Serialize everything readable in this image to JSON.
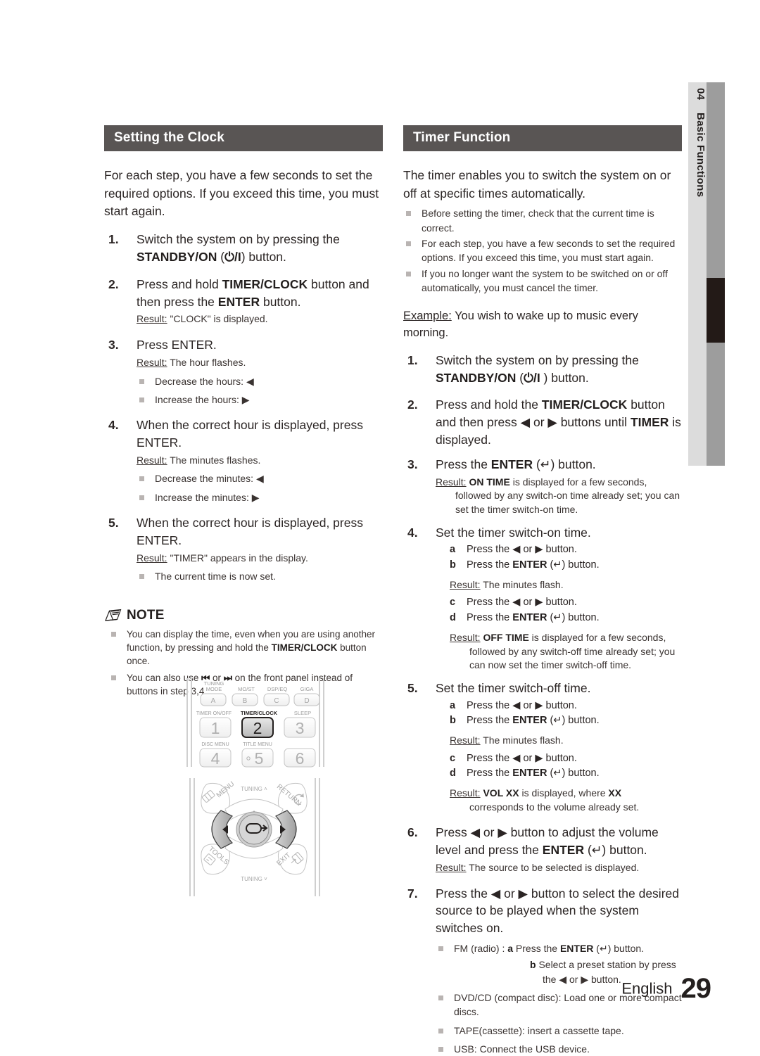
{
  "tab": {
    "number": "04",
    "label": "Basic Functions"
  },
  "left": {
    "heading": "Setting the Clock",
    "intro": "For each step, you have a few seconds to set the required options. If you exceed this time, you must start again.",
    "steps": [
      {
        "num": "1.",
        "text_a": "Switch the system on by pressing the ",
        "bold_b": "STANDBY/ON",
        "text_c": " (",
        "symbol": "⏻/I",
        "text_d": ") button."
      },
      {
        "num": "2.",
        "text_a": "Press and hold ",
        "bold_b": "TIMER/CLOCK",
        "text_c": " button and then press the ",
        "bold_d": "ENTER",
        "text_e": " button.",
        "result_label": "Result:",
        "result_text": " \"CLOCK\" is displayed."
      },
      {
        "num": "3.",
        "text_a": "Press ENTER.",
        "result_label": "Result:",
        "result_text": " The hour flashes.",
        "bullets": [
          "Decrease the hours: ◀",
          "Increase the hours: ▶"
        ]
      },
      {
        "num": "4.",
        "text_a": "When the correct hour is displayed, press ENTER.",
        "result_label": "Result:",
        "result_text": " The minutes flashes.",
        "bullets": [
          "Decrease the minutes: ◀",
          "Increase the minutes: ▶"
        ]
      },
      {
        "num": "5.",
        "text_a": "When the correct hour is displayed, press ENTER.",
        "result_label": "Result:",
        "result_text": " \"TIMER\" appears in the display.",
        "bullets": [
          "The current time is now set."
        ]
      }
    ],
    "note": {
      "title": "NOTE",
      "items": [
        {
          "a": "You can display the time, even when you are using another function, by pressing and hold the ",
          "b": "TIMER/CLOCK",
          "c": " button once."
        },
        {
          "a": "You can also use ",
          "b": "⏮",
          "c": " or ",
          "d": "⏭",
          "e": " on the front panel instead of buttons in step 3,4."
        }
      ]
    }
  },
  "remote": {
    "row_labels_top": [
      "TUNING MODE",
      "MO/ST",
      "DSP/EQ",
      "GIGA"
    ],
    "keys_top": [
      "A",
      "B",
      "C",
      "D"
    ],
    "row_labels_mid": [
      "TIMER ON/OFF",
      "TIMER/CLOCK",
      "SLEEP"
    ],
    "keys_mid": [
      "1",
      "2",
      "3"
    ],
    "row_labels_bottom": [
      "DISC MENU",
      "TITLE MENU",
      ""
    ],
    "keys_bottom": [
      "4",
      "5",
      "6"
    ],
    "highlighted_key": "2",
    "dpad": {
      "menu": "MENU",
      "return": "RETURN",
      "tools": "TOOLS",
      "exit": "EXIT",
      "tuning_up": "TUNING ˄",
      "tuning_down": "TUNING ˅"
    }
  },
  "right": {
    "heading": "Timer Function",
    "intro": "The timer enables you to switch the system on or off at specific times automatically.",
    "intro_bullets": [
      "Before setting the timer, check that the current time is correct.",
      "For each step, you have a few seconds to set the required options. If you exceed this time, you must start again.",
      "If you no longer want the system to be switched on or off automatically, you must cancel the timer."
    ],
    "example_label": "Example:",
    "example_text": " You wish to wake up to music every morning.",
    "steps": [
      {
        "num": "1.",
        "text_a": "Switch the system on by pressing the ",
        "bold_b": "STANDBY/ON",
        "text_c": " (",
        "symbol": "⏻/I",
        "text_d": " ) button."
      },
      {
        "num": "2.",
        "text_a": "Press and hold the ",
        "bold_b": "TIMER/CLOCK",
        "text_c": " button and then press ◀ or ▶ buttons until ",
        "bold_d": "TIMER",
        "text_e": " is displayed."
      },
      {
        "num": "3.",
        "text_a": "Press the ",
        "bold_b": "ENTER",
        "text_c": " (↵) button.",
        "result_label": "Result:",
        "result_bold": "  ON TIME",
        "result_text": " is displayed for a few seconds,",
        "result_cont": "followed by any switch-on time already set; you can set the timer switch-on time."
      },
      {
        "num": "4.",
        "text_a": "Set the timer switch-on time.",
        "letters": [
          {
            "l": "a",
            "t": "Press the ◀ or ▶ button."
          },
          {
            "l": "b",
            "t_a": "Press the ",
            "t_b": "ENTER",
            "t_c": " (↵) button."
          }
        ],
        "result1_label": "Result:",
        "result1_text": " The minutes flash.",
        "letters2": [
          {
            "l": "c",
            "t": "Press the ◀ or ▶ button."
          },
          {
            "l": "d",
            "t_a": "Press the ",
            "t_b": "ENTER",
            "t_c": " (↵) button."
          }
        ],
        "result2_label": "Result:",
        "result2_bold": " OFF TIME",
        "result2_text": " is displayed for a few seconds,",
        "result2_cont": "followed by any switch-off time already set; you can now set the timer switch-off time."
      },
      {
        "num": "5.",
        "text_a": "Set the timer switch-off time.",
        "letters": [
          {
            "l": "a",
            "t": "Press the ◀ or ▶ button."
          },
          {
            "l": "b",
            "t_a": "Press the ",
            "t_b": "ENTER",
            "t_c": " (↵) button."
          }
        ],
        "result1_label": "Result:",
        "result1_text": " The minutes flash.",
        "letters2": [
          {
            "l": "c",
            "t": "Press the  ◀ or ▶ button."
          },
          {
            "l": "d",
            "t_a": "Press the ",
            "t_b": "ENTER",
            "t_c": " (↵) button."
          }
        ],
        "result2_label": "Result:",
        "result2_bold": " VOL XX",
        "result2_text": " is displayed, where ",
        "result2_bold2": "XX",
        "result2_cont": "corresponds to the volume already set."
      },
      {
        "num": "6.",
        "text_a": "Press ◀ or ▶ button to adjust the volume level and press the ",
        "bold_b": "ENTER",
        "text_c": " (↵) button.",
        "result_label": "Result:",
        "result_text": " The source to be selected is displayed."
      },
      {
        "num": "7.",
        "text_a": "Press the ◀ or ▶ button to select the desired source to be played when the system switches on.",
        "fm_bullet_a": "FM (radio) : ",
        "fm_letter_a": "a",
        "fm_text_a1": "  Press the ",
        "fm_text_a2": "ENTER",
        "fm_text_a3": " (↵) button.",
        "fm_letter_b": "b",
        "fm_text_b": "  Select a preset station by press",
        "fm_text_b2": "the  ◀ or ▶ button.",
        "bullets": [
          "DVD/CD (compact disc): Load one or more compact discs.",
          "TAPE(cassette): insert a cassette tape.",
          "USB: Connect the USB device."
        ]
      }
    ]
  },
  "footer": {
    "language": "English",
    "page_number": "29"
  },
  "colors": {
    "heading_bar": "#595554",
    "tab_light": "#dcdcdc",
    "tab_mid": "#9d9d9d",
    "tab_dark": "#231a17",
    "bullet": "#b9b4b2",
    "text": "#231f1e"
  }
}
